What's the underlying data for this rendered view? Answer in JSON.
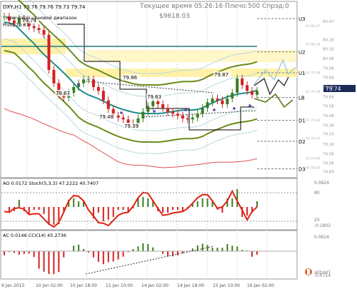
{
  "header": {
    "symbol_line": "DXY,H1  79.76 79.76 79.73 79.74",
    "indicator_title": "Ключевой ценовой диапазон",
    "pivot_label": "Pivot 79.67",
    "time_line": "Текущее время 05:26:16 Плечо:500 Спрэд:0",
    "equity_line": "$9618.03"
  },
  "price_panel": {
    "right_axis": [
      "80.47",
      "80.28",
      "80.18",
      "80.08",
      "79.98",
      "79.88",
      "79.78",
      "79.68",
      "79.58",
      "79.48",
      "79.38",
      "79.29",
      "79.18",
      "79.08",
      "78.98",
      "78.89"
    ],
    "last_price": "79.74",
    "levels": [
      {
        "label": "U3",
        "price": 80.5
      },
      {
        "label": "U2",
        "price": 80.15
      },
      {
        "label": "U1",
        "price": 79.93
      },
      {
        "label": "LB",
        "price": 79.67
      },
      {
        "label": "D1",
        "price": 79.43
      },
      {
        "label": "D2",
        "price": 79.21
      },
      {
        "label": "D3",
        "price": 78.92
      }
    ],
    "price_labels": [
      "79.74",
      "79.67",
      "79.86",
      "79.48",
      "79.39",
      "79.63",
      "79.87"
    ],
    "tiny_labels": [
      "R4 80.47",
      "R3 80.28",
      "R2 79.98",
      "R1 79.78",
      "S1 79.48",
      "S2 79.29",
      "S3 79.08",
      "S4 78.98"
    ]
  },
  "ao_panel": {
    "label": "AO 0.0172  Stoch(5,3,3) 47.2222 40.7407",
    "right_axis": [
      "0.0824",
      "80",
      "20",
      "-0.1802"
    ]
  },
  "acc_panel": {
    "label": "AC 0.0146  CCI(14) 45.2736",
    "right_axis": [
      "0.0624",
      "-0.0714"
    ]
  },
  "x_axis": [
    "9 Jan 2013",
    "10 Jan 02:00",
    "10 Jan 18:00",
    "11 Jan 10:00",
    "14 Jan 02:00",
    "14 Jan 18:00",
    "15 Jan 10:00",
    "16 Jan 02:00"
  ],
  "brand": {
    "name": "alpari",
    "color": "#e0622a"
  },
  "colors": {
    "bull": "#3a7d1f",
    "bear": "#d42020",
    "ma_teal": "#1f8a8a",
    "env_olive": "#6b8a1a",
    "zone": "#fff2a8",
    "stoch": "#e02010"
  },
  "chart_data": {
    "type": "candlestick",
    "symbol": "DXY",
    "timeframe": "H1",
    "ohlc_last": {
      "open": 79.76,
      "high": 79.76,
      "low": 79.73,
      "close": 79.74
    },
    "close_series": [
      80.52,
      80.48,
      80.45,
      80.5,
      80.47,
      80.42,
      80.4,
      80.38,
      80.33,
      79.96,
      79.82,
      79.7,
      79.67,
      79.72,
      79.78,
      79.82,
      79.86,
      79.86,
      79.78,
      79.74,
      79.64,
      79.55,
      79.48,
      79.46,
      79.44,
      79.4,
      79.39,
      79.45,
      79.52,
      79.58,
      79.63,
      79.6,
      79.56,
      79.52,
      79.5,
      79.48,
      79.45,
      79.44,
      79.46,
      79.5,
      79.56,
      79.62,
      79.66,
      79.64,
      79.6,
      79.66,
      79.72,
      79.87,
      79.8,
      79.74,
      79.7,
      79.74
    ],
    "levels": {
      "U3": 80.5,
      "U2": 80.15,
      "U1": 79.93,
      "LB": 79.67,
      "D1": 79.43,
      "D2": 79.21,
      "D3": 78.92
    },
    "ylim": [
      78.85,
      80.62
    ],
    "indicators": [
      {
        "name": "AO",
        "value": 0.0172,
        "range": [
          -0.1802,
          0.0824
        ]
      },
      {
        "name": "Stoch(5,3,3)",
        "values": [
          47.2222,
          40.7407
        ],
        "levels": [
          80,
          20
        ]
      },
      {
        "name": "AC",
        "value": 0.0146,
        "range": [
          -0.0714,
          0.0624
        ]
      },
      {
        "name": "CCI(14)",
        "value": 45.2736
      }
    ],
    "x_ticks": [
      "9 Jan 2013",
      "10 Jan 02:00",
      "10 Jan 18:00",
      "11 Jan 10:00",
      "14 Jan 02:00",
      "14 Jan 18:00",
      "15 Jan 10:00",
      "16 Jan 02:00"
    ]
  }
}
